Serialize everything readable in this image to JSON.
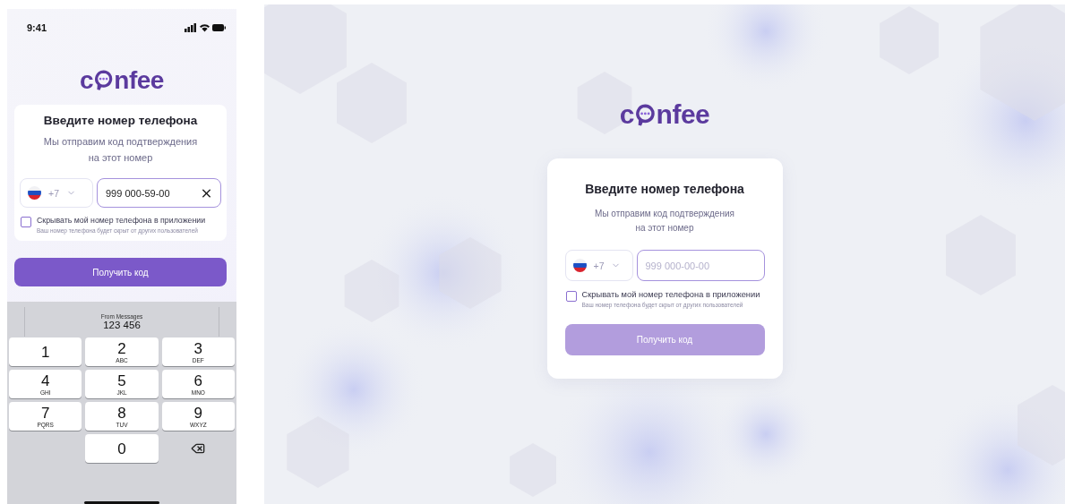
{
  "mobile": {
    "status_time": "9:41",
    "logo": {
      "before": "c",
      "after": "nfee"
    },
    "form": {
      "title": "Введите номер телефона",
      "subtitle": "Мы отправим код подтверждения на этот номер",
      "country_code": "+7",
      "phone": {
        "value": "999 000-59-00"
      },
      "hide_number": {
        "label": "Скрывать мой номер телефона в приложении",
        "hint": "Ваш номер телефона будет скрыт от других пользователей",
        "checked": false
      }
    },
    "submit": {
      "label": "Получить код",
      "disabled": false
    },
    "keyboard": {
      "suggestion_source": "From Messages",
      "suggestion": "123 456",
      "keys": [
        {
          "digit": "1"
        },
        {
          "digit": "2",
          "letters": "ABC"
        },
        {
          "digit": "3",
          "letters": "DEF"
        },
        {
          "digit": "4",
          "letters": "GHI"
        },
        {
          "digit": "5",
          "letters": "JKL"
        },
        {
          "digit": "6",
          "letters": "MNO"
        },
        {
          "digit": "7",
          "letters": "PQRS"
        },
        {
          "digit": "8",
          "letters": "TUV"
        },
        {
          "digit": "9",
          "letters": "WXYZ"
        },
        {
          "digit": "0"
        }
      ]
    }
  },
  "desktop": {
    "logo": {
      "before": "c",
      "after": "nfee"
    },
    "form": {
      "title": "Введите номер телефона",
      "subtitle": "Мы отправим код подтверждения на этот номер",
      "country_code": "+7",
      "phone": {
        "placeholder": "999 000-00-00"
      },
      "hide_number": {
        "label": "Скрывать мой номер телефона в приложении",
        "hint": "Ваш номер телефона будет скрыт от других пользователей",
        "checked": false
      }
    },
    "submit": {
      "label": "Получить код",
      "disabled": true
    }
  }
}
